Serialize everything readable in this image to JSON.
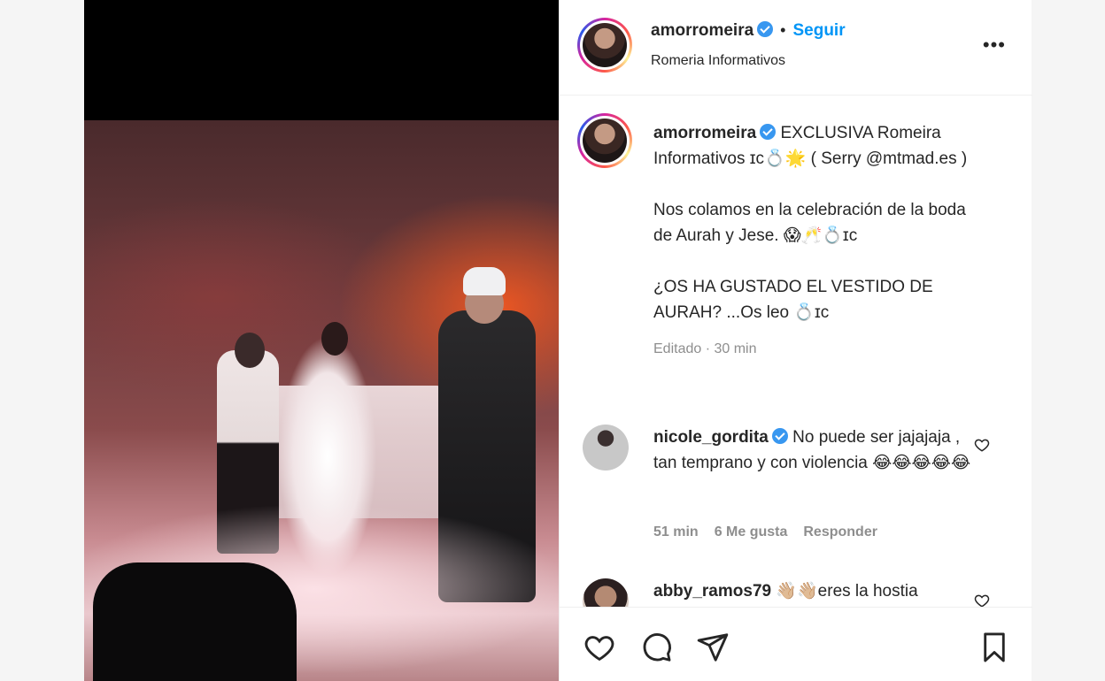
{
  "post": {
    "author": "amorromeira",
    "follow_label": "Seguir",
    "dot": "•",
    "location": "Romeria Informativos",
    "more_label": "•••"
  },
  "caption": {
    "author": "amorromeira",
    "line1": " EXCLUSIVA Romeira Informativos ɪᴄ💍🌟 ( Serry @mtmad.es )",
    "line2": "Nos colamos en la celebración de la boda de Aurah y Jese. 😱🥂💍ɪᴄ",
    "line3": "¿OS HA GUSTADO EL VESTIDO DE AURAH? ...Os leo 💍ɪᴄ",
    "edited": "Editado",
    "sep": " · ",
    "time": "30 min"
  },
  "comments": [
    {
      "author": "nicole_gordita",
      "text": " No puede ser jajajaja , tan temprano y con violencia 😂😂😂😂😂",
      "time": "51 min",
      "likes": "6 Me gusta",
      "reply": "Responder"
    },
    {
      "author": "abby_ramos79",
      "text": " 👋🏼👋🏼eres la hostia"
    }
  ],
  "icons": {
    "like": "heart-icon",
    "comment": "comment-icon",
    "share": "paper-plane-icon",
    "save": "bookmark-icon"
  },
  "colors": {
    "follow": "#0095f6",
    "verified": "#3897f0",
    "muted": "#8e8e8e"
  }
}
